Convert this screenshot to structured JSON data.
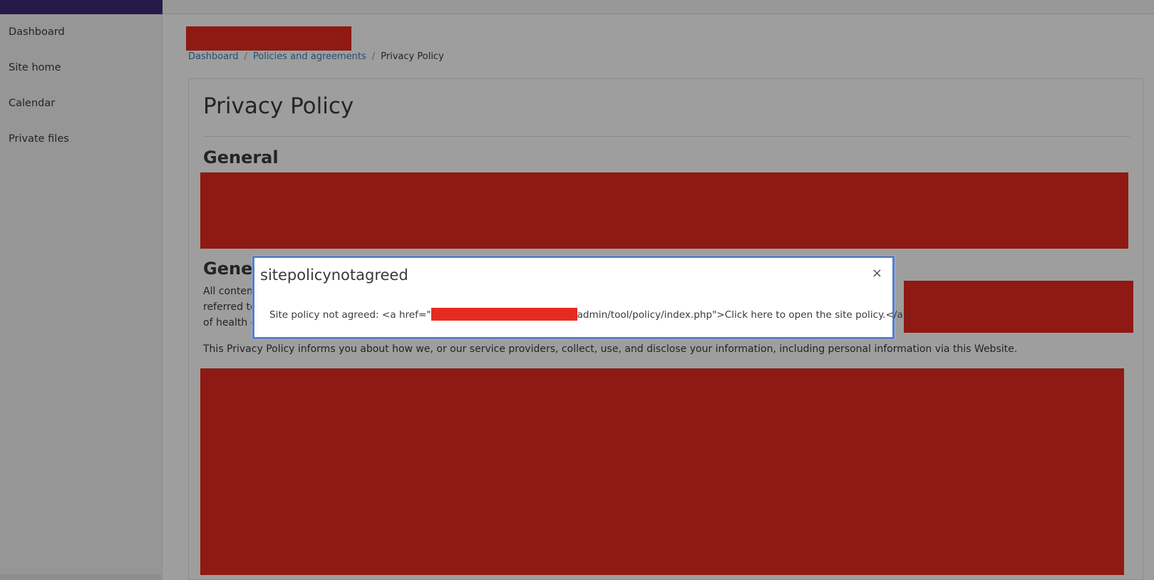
{
  "sidebar": {
    "items": [
      {
        "label": "Dashboard"
      },
      {
        "label": "Site home"
      },
      {
        "label": "Calendar"
      },
      {
        "label": "Private files"
      }
    ]
  },
  "breadcrumb": {
    "items": [
      {
        "label": "Dashboard"
      },
      {
        "label": "Policies and agreements"
      },
      {
        "label": "Privacy Policy"
      }
    ],
    "separator": "/"
  },
  "page": {
    "title": "Privacy Policy",
    "section1_heading": "General",
    "section2_heading": "Genera",
    "para1_line1": "All content",
    "para1_line2": "referred to",
    "para1_line3": "of health d",
    "para2": "This Privacy Policy informs you about how we, or our service providers, collect, use, and disclose your information, including personal information via this Website."
  },
  "modal": {
    "title": "sitepolicynotagreed",
    "close_label": "×",
    "body_prefix": "Site policy not agreed: <a href=\"",
    "body_suffix": "admin/tool/policy/index.php\">Click here to open the site policy.</a>"
  },
  "colors": {
    "redaction": "#e52a20",
    "brand": "#3a2d7a",
    "link": "#3a7fb8",
    "modal_border": "#5b7fbf"
  }
}
